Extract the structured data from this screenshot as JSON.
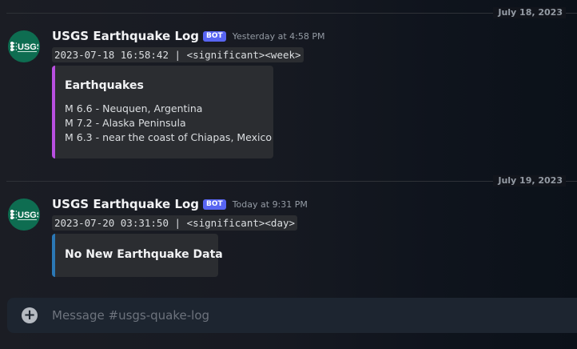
{
  "days": [
    {
      "date": "July 18, 2023",
      "message": {
        "author": "USGS Earthquake Log",
        "badge": "BOT",
        "timestamp": "Yesterday at 4:58 PM",
        "code": "2023-07-18 16:58:42 | <significant><week>",
        "embed": {
          "title": "Earthquakes",
          "accent_color": "#b94fe0",
          "lines": [
            "M 6.6 - Neuquen, Argentina",
            "M 7.2 - Alaska Peninsula",
            "M 6.3 - near the coast of Chiapas, Mexico"
          ]
        }
      }
    },
    {
      "date": "July 19, 2023",
      "message": {
        "author": "USGS Earthquake Log",
        "badge": "BOT",
        "timestamp": "Today at 9:31 PM",
        "code": "2023-07-20 03:31:50 | <significant><day>",
        "embed": {
          "title": "No New Earthquake Data",
          "accent_color": "#2b78b6"
        }
      }
    }
  ],
  "avatar": {
    "label": "USGS",
    "icon": "usgs-logo-icon",
    "color": "#0e6d51"
  },
  "composer": {
    "placeholder": "Message #usgs-quake-log",
    "add_icon": "plus-circle-icon"
  }
}
